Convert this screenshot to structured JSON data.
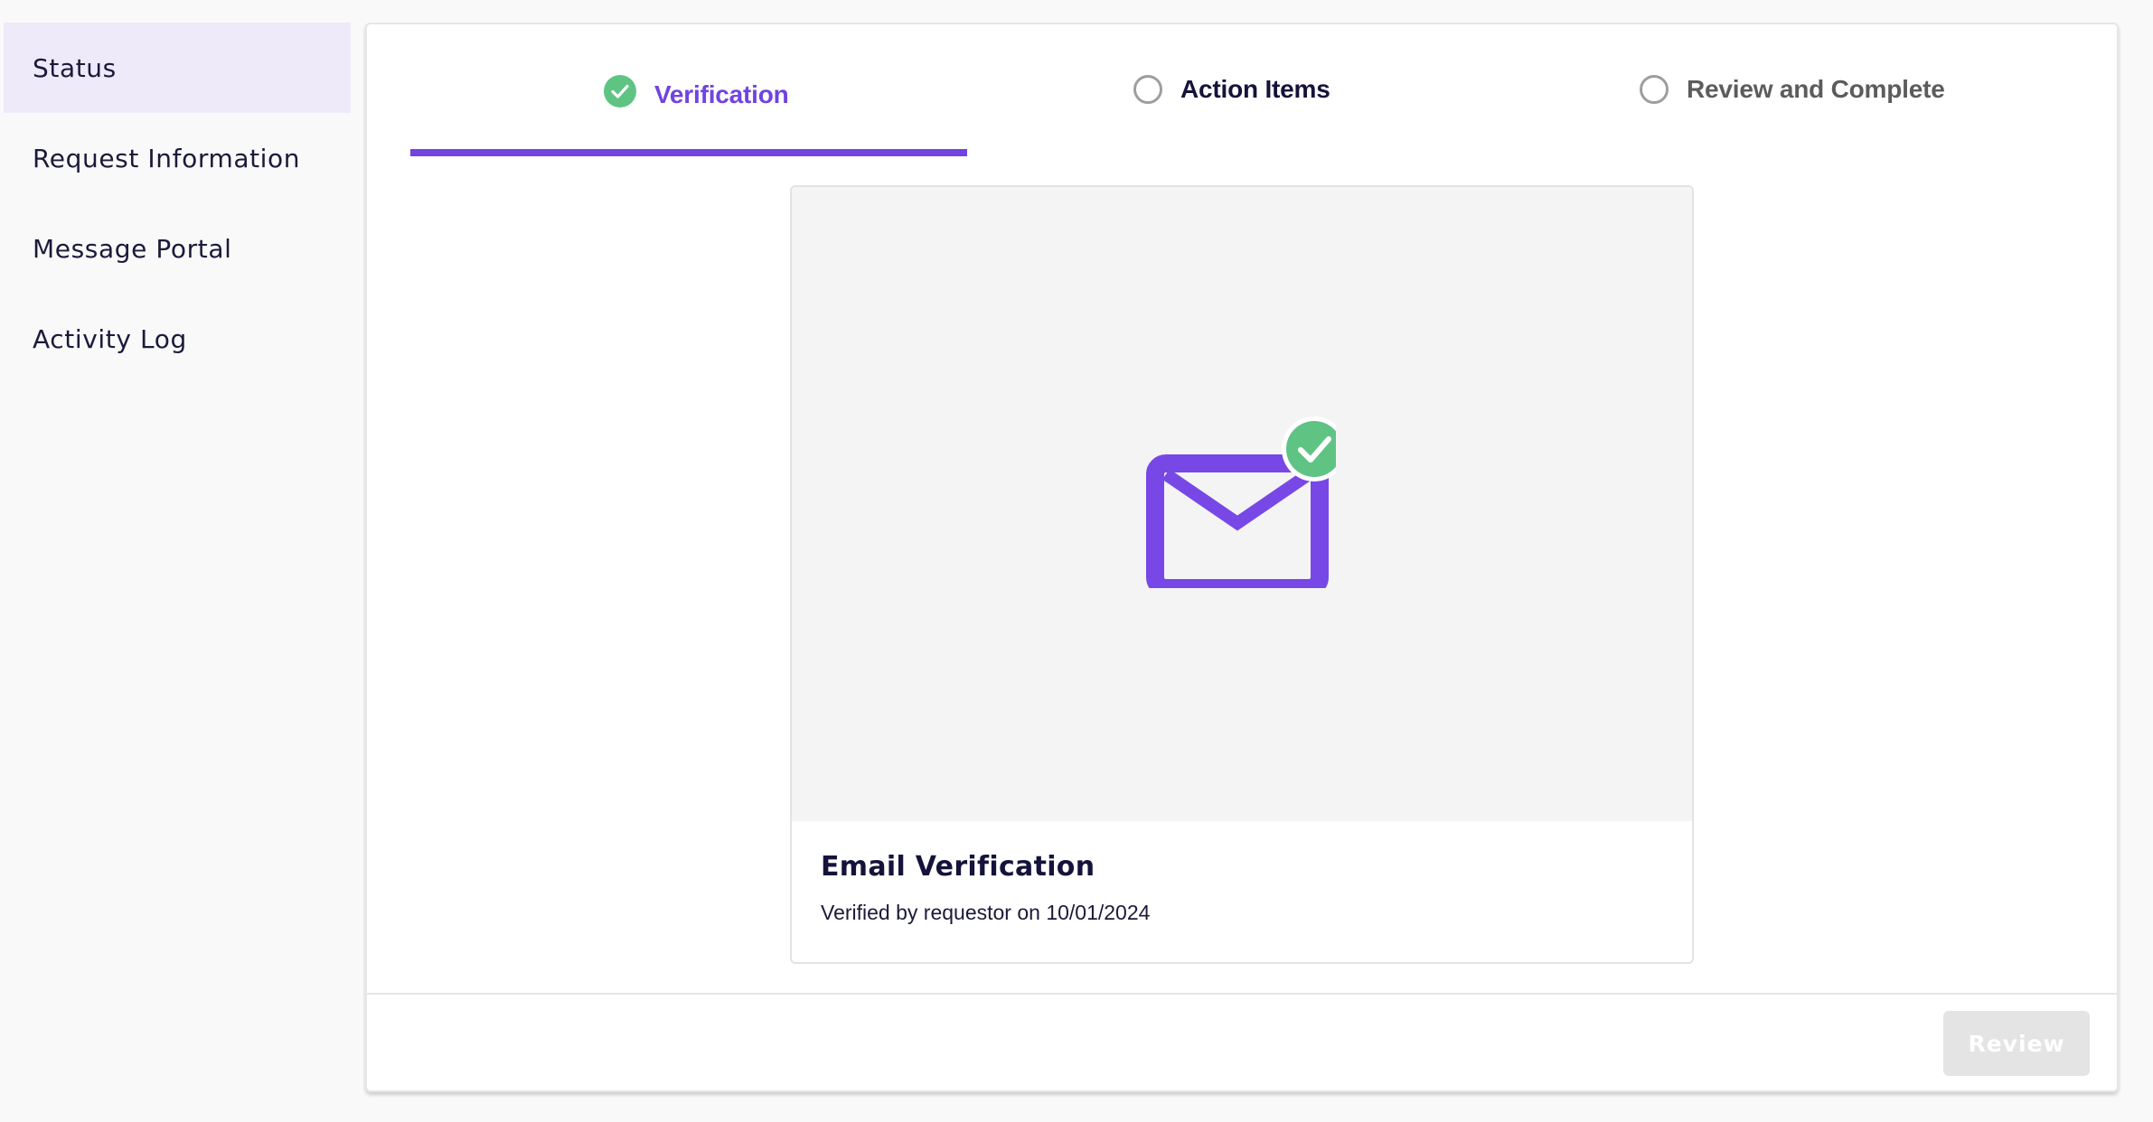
{
  "sidebar": {
    "items": [
      {
        "label": "Status",
        "active": true
      },
      {
        "label": "Request Information",
        "active": false
      },
      {
        "label": "Message Portal",
        "active": false
      },
      {
        "label": "Activity Log",
        "active": false
      }
    ]
  },
  "stepper": {
    "steps": [
      {
        "label": "Verification",
        "state": "completed",
        "icon": "check-circle-icon"
      },
      {
        "label": "Action Items",
        "state": "pending",
        "icon": "empty-circle-icon"
      },
      {
        "label": "Review and Complete",
        "state": "pending",
        "icon": "empty-circle-icon"
      }
    ]
  },
  "verification": {
    "title": "Email Verification",
    "subtitle": "Verified by requestor on 10/01/2024",
    "icon": "envelope-check-icon"
  },
  "footer": {
    "review_label": "Review"
  },
  "colors": {
    "accent": "#7143e0",
    "success": "#5fc483",
    "sidebar_active_bg": "#efeafa",
    "disabled_button": "#e4e4e4"
  }
}
